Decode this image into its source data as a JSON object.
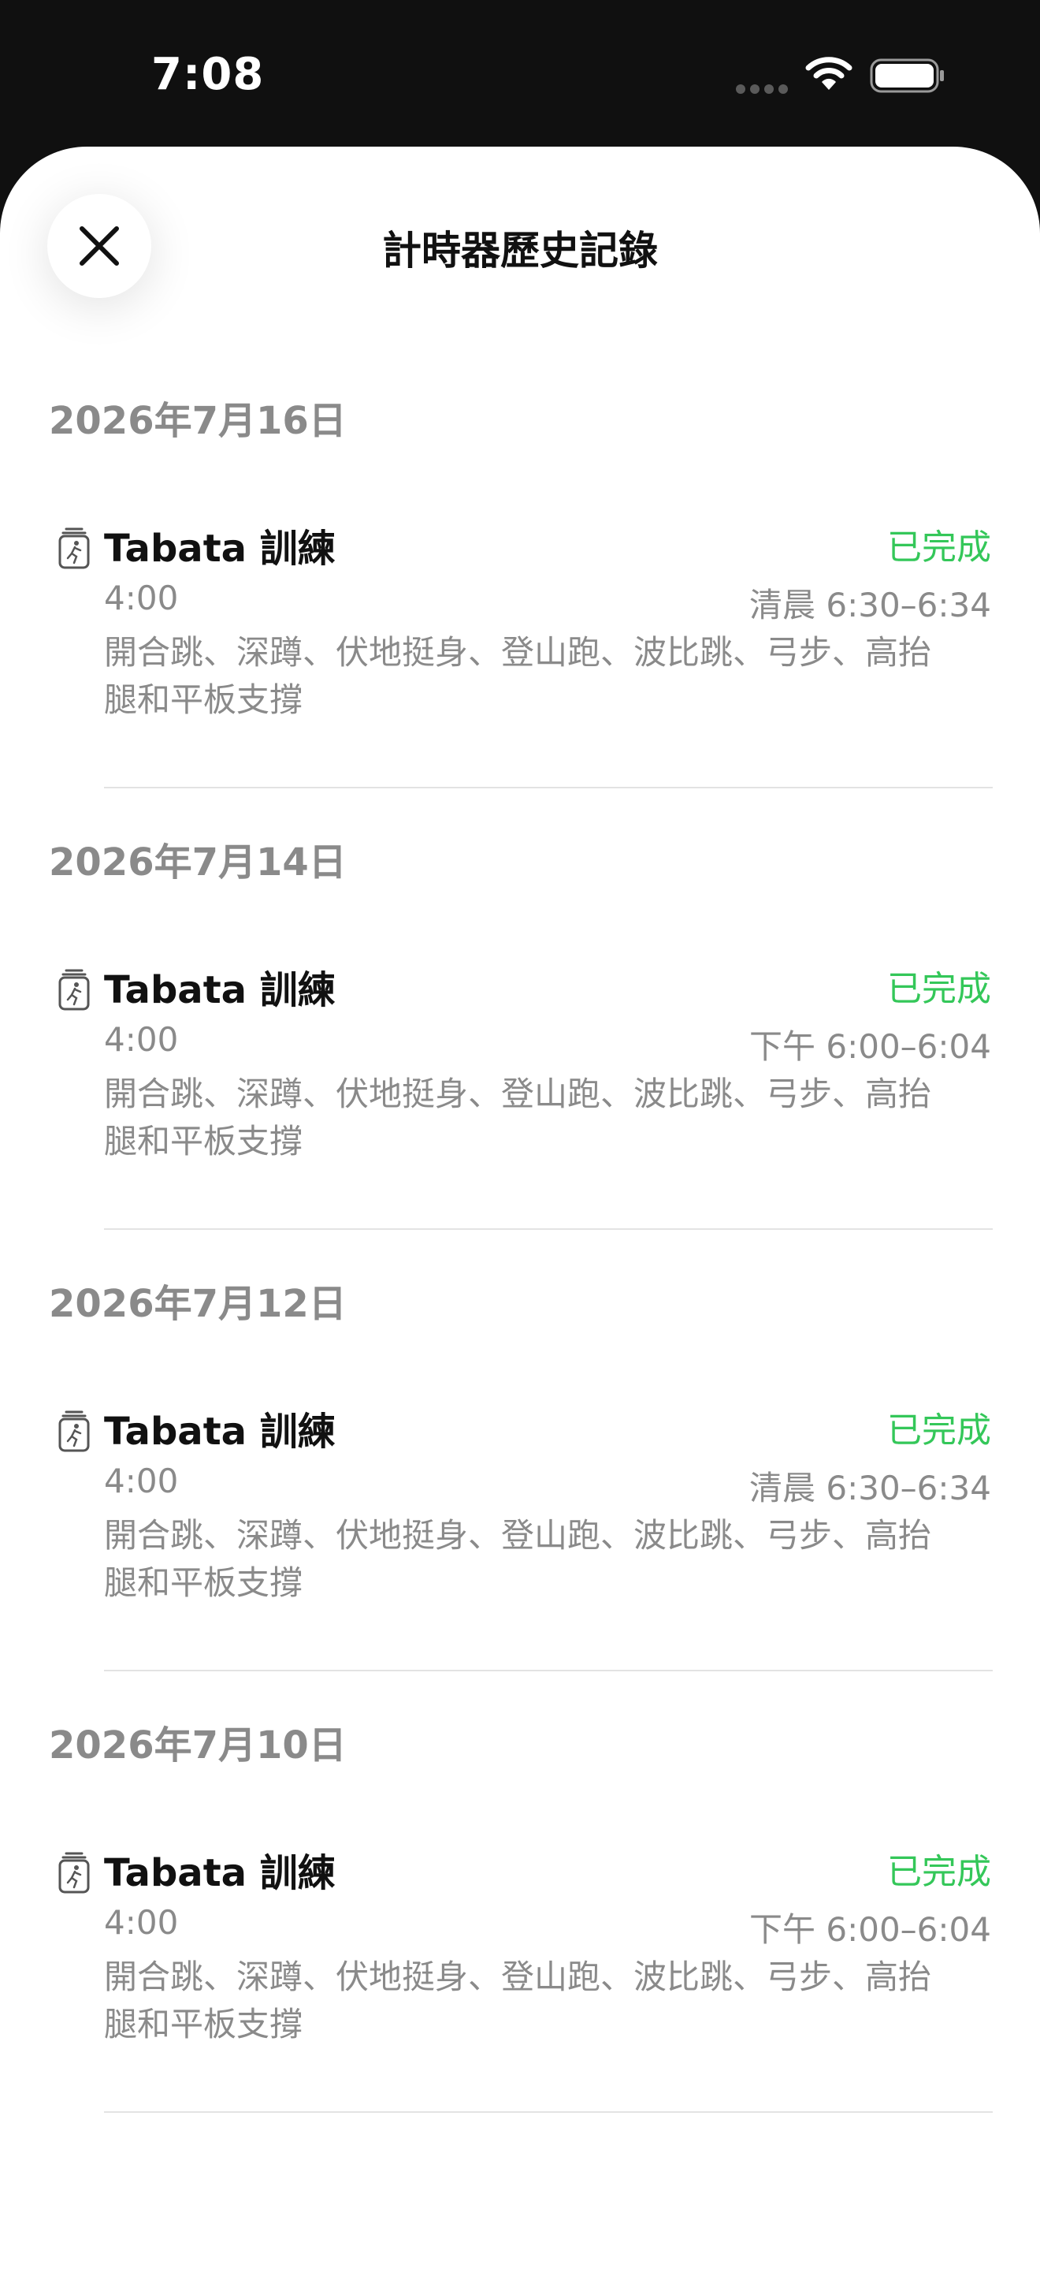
{
  "status_bar": {
    "time": "7:08"
  },
  "header": {
    "title": "計時器歷史記錄"
  },
  "days": [
    {
      "date": "2026年7月16日",
      "session": {
        "title": "Tabata 訓練",
        "status": "已完成",
        "duration": "4:00",
        "time_range": "清晨 6:30–6:34",
        "exercises": "開合跳、深蹲、伏地挺身、登山跑、波比跳、弓步、高抬腿和平板支撐"
      }
    },
    {
      "date": "2026年7月14日",
      "session": {
        "title": "Tabata 訓練",
        "status": "已完成",
        "duration": "4:00",
        "time_range": "下午 6:00–6:04",
        "exercises": "開合跳、深蹲、伏地挺身、登山跑、波比跳、弓步、高抬腿和平板支撐"
      }
    },
    {
      "date": "2026年7月12日",
      "session": {
        "title": "Tabata 訓練",
        "status": "已完成",
        "duration": "4:00",
        "time_range": "清晨 6:30–6:34",
        "exercises": "開合跳、深蹲、伏地挺身、登山跑、波比跳、弓步、高抬腿和平板支撐"
      }
    },
    {
      "date": "2026年7月10日",
      "session": {
        "title": "Tabata 訓練",
        "status": "已完成",
        "duration": "4:00",
        "time_range": "下午 6:00–6:04",
        "exercises": "開合跳、深蹲、伏地挺身、登山跑、波比跳、弓步、高抬腿和平板支撐"
      }
    }
  ],
  "colors": {
    "accent_green": "#34c759",
    "secondary_text": "#8a8a8a"
  },
  "icons": {
    "close": "close-icon",
    "workout": "workout-timer-icon"
  }
}
